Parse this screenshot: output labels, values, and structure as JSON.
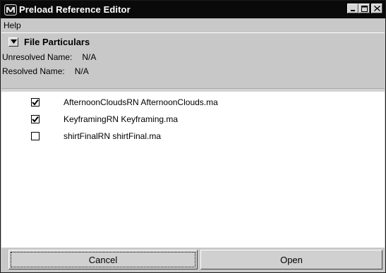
{
  "window": {
    "title": "Preload Reference Editor",
    "icon": "maya-icon",
    "controls": {
      "minimize": "_",
      "maximize": "□",
      "close": "×"
    }
  },
  "menubar": {
    "items": [
      "Help"
    ]
  },
  "file_particulars": {
    "title": "File Particulars",
    "collapse_icon": "triangle-down-icon",
    "unresolved_label": "Unresolved Name:",
    "unresolved_value": "N/A",
    "resolved_label": "Resolved Name:",
    "resolved_value": "N/A"
  },
  "references": [
    {
      "label": "AfternoonCloudsRN AfternoonClouds.ma",
      "checked": true
    },
    {
      "label": "KeyframingRN Keyframing.ma",
      "checked": true
    },
    {
      "label": "shirtFinalRN shirtFinal.ma",
      "checked": false
    }
  ],
  "buttons": {
    "cancel": "Cancel",
    "open": "Open"
  }
}
